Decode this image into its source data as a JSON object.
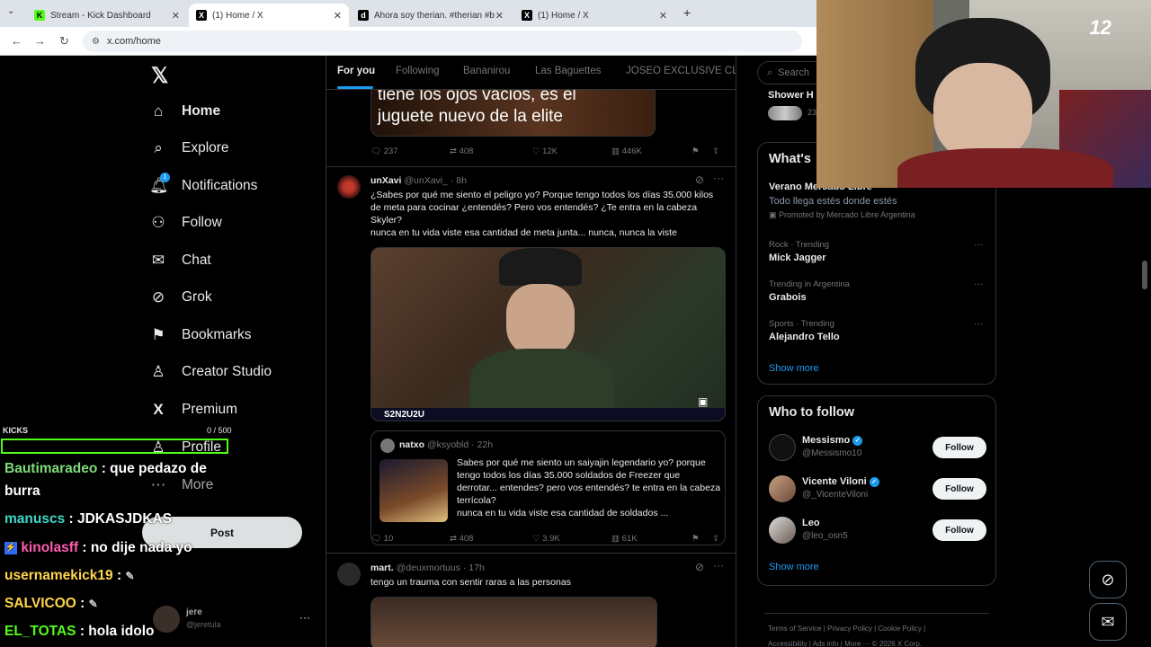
{
  "browser": {
    "tabs": [
      {
        "title": "Stream - Kick Dashboard",
        "favicon": "K",
        "color": "#53fc18"
      },
      {
        "title": "(1) Home / X",
        "favicon": "X",
        "color": "#000000"
      },
      {
        "title": "Ahora soy therian. #therian #b",
        "favicon": "d",
        "color": "#000000"
      },
      {
        "title": "(1) Home / X",
        "favicon": "X",
        "color": "#000000"
      }
    ],
    "url": "x.com/home"
  },
  "nav": {
    "items": [
      {
        "label": "Home",
        "icon": "home-icon",
        "glyph": "⌂"
      },
      {
        "label": "Explore",
        "icon": "search-icon",
        "glyph": "⌕"
      },
      {
        "label": "Notifications",
        "icon": "bell-icon",
        "glyph": "🔔︎"
      },
      {
        "label": "Follow",
        "icon": "person-plus-icon",
        "glyph": "⚇"
      },
      {
        "label": "Chat",
        "icon": "mail-icon",
        "glyph": "✉"
      },
      {
        "label": "Grok",
        "icon": "grok-icon",
        "glyph": "⊘"
      },
      {
        "label": "Bookmarks",
        "icon": "bookmark-icon",
        "glyph": "⚑"
      },
      {
        "label": "Creator Studio",
        "icon": "creator-icon",
        "glyph": "♙"
      },
      {
        "label": "Premium",
        "icon": "x-logo-icon",
        "glyph": "X"
      },
      {
        "label": "Profile",
        "icon": "profile-icon",
        "glyph": "♙"
      },
      {
        "label": "More",
        "icon": "more-icon",
        "glyph": "⋯"
      }
    ],
    "notifications_badge": "1",
    "post_label": "Post",
    "account": {
      "name": "jere",
      "handle": "@jeretula"
    }
  },
  "timeline": {
    "tabs": [
      "For you",
      "Following",
      "Bananirou",
      "Las Baguettes",
      "JOSEO EXCLUSIVE CLU"
    ],
    "top_media_caption": "tiene los ojos vacios, es el\njuguete nuevo de la elite",
    "top_actions": {
      "replies": "237",
      "reposts": "408",
      "likes": "12K",
      "views": "446K"
    },
    "post1": {
      "name": "unXavi",
      "handle": "@unXavi_ · 8h",
      "text": "¿Sabes por qué me siento el peligro yo? Porque tengo todos los días 35.000 kilos de meta para cocinar ¿entendés? Pero vos entendés? ¿Te entra en la cabeza Skyler?\nnunca en tu vida viste esa cantidad de meta junta... nunca, nunca la viste",
      "media_overlay": "S2N2U2U",
      "quote": {
        "name": "natxo",
        "handle": "@ksyobld · 22h",
        "text": "Sabes por qué me siento un saiyajin legendario yo? porque tengo todos los días 35.000 soldados de Freezer que derrotar... entendes? pero vos entendés? te entra en la cabeza terrícola?\nnunca en tu vida viste esa cantidad de soldados ..."
      },
      "actions": {
        "replies": "10",
        "reposts": "408",
        "likes": "3.9K",
        "views": "61K"
      }
    },
    "post2": {
      "name": "mart.",
      "handle": "@deuxmortuus · 17h",
      "text": "tengo un trauma con sentir raras a las personas"
    }
  },
  "sidebar": {
    "search_placeholder": "Search",
    "shower_label": "Shower H",
    "shower_count": "23",
    "whats_title": "What's",
    "promo": {
      "title": "Verano Mercado Libre",
      "subtitle": "Todo llega estés donde estés",
      "promoted": "Promoted by Mercado Libre Argentina"
    },
    "trends": [
      {
        "meta": "Rock · Trending",
        "name": "Mick Jagger"
      },
      {
        "meta": "Trending in Argentina",
        "name": "Grabois"
      },
      {
        "meta": "Sports · Trending",
        "name": "Alejandro Tello"
      }
    ],
    "show_more": "Show more",
    "who_title": "Who to follow",
    "who": [
      {
        "name": "Messismo",
        "handle": "@Messismo10",
        "verified": true
      },
      {
        "name": "Vicente Viloni",
        "handle": "@_VicenteViloni",
        "verified": true
      },
      {
        "name": "Leo",
        "handle": "@leo_osn5",
        "verified": false
      }
    ],
    "follow_label": "Follow",
    "footer1": "Terms of Service  |  Privacy Policy  |  Cookie Policy  |",
    "footer2": "Accessibility  |  Ads info  |  More ···  © 2026 X Corp."
  },
  "overlay": {
    "chat_label": "KICKS",
    "chat_count": "0 / 500",
    "messages": [
      {
        "user": "Bautimaradeo",
        "text": ": que pedazo de",
        "color": "#7fdc7a"
      },
      {
        "user": "",
        "text": "burra",
        "color": "#ffffff"
      },
      {
        "user": "manuscs",
        "text": ": JDKASJDKAS",
        "color": "#40d8c8"
      },
      {
        "user": "kinolasff",
        "text": ": no dije nada yo",
        "color": "#ff5bb0"
      },
      {
        "user": "usernamekick19",
        "text": ":",
        "color": "#ffd54a"
      },
      {
        "user": "SALVICOO",
        "text": ":",
        "color": "#ffd54a"
      },
      {
        "user": "EL_TOTAS",
        "text": ": hola idolo",
        "color": "#53fc18"
      }
    ],
    "cam_sub": "12"
  }
}
